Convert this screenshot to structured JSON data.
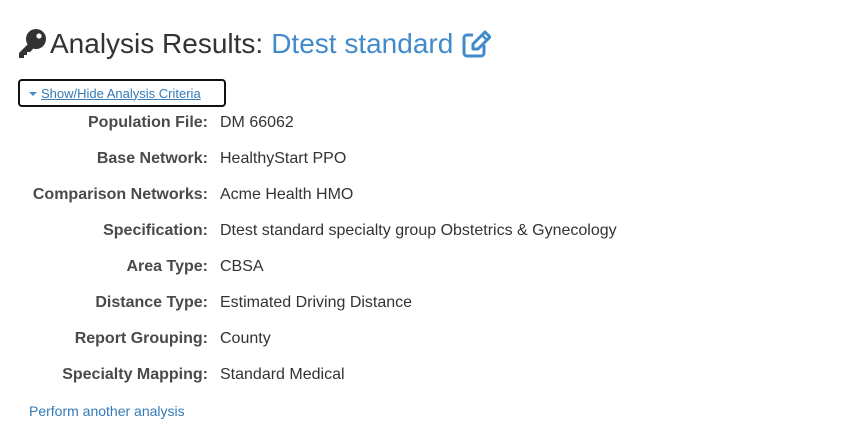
{
  "header": {
    "title_prefix": "Analysis Results:",
    "analysis_name": "Dtest standard",
    "icons": {
      "leading": "key-icon",
      "edit": "edit-icon"
    }
  },
  "toggle": {
    "label": "Show/Hide Analysis Criteria",
    "icon": "caret-down-icon"
  },
  "criteria": [
    {
      "label": "Population File:",
      "value": "DM 66062"
    },
    {
      "label": "Base Network:",
      "value": "HealthyStart PPO"
    },
    {
      "label": "Comparison Networks:",
      "value": "Acme Health HMO"
    },
    {
      "label": "Specification:",
      "value": "Dtest standard specialty group Obstetrics & Gynecology"
    },
    {
      "label": "Area Type:",
      "value": "CBSA"
    },
    {
      "label": "Distance Type:",
      "value": "Estimated Driving Distance"
    },
    {
      "label": "Report Grouping:",
      "value": "County"
    },
    {
      "label": "Specialty Mapping:",
      "value": "Standard Medical"
    }
  ],
  "footer": {
    "perform_another_label": "Perform another analysis"
  },
  "colors": {
    "accent": "#428bca",
    "link": "#337ab7",
    "text": "#333333",
    "label": "#4a4a4a"
  }
}
